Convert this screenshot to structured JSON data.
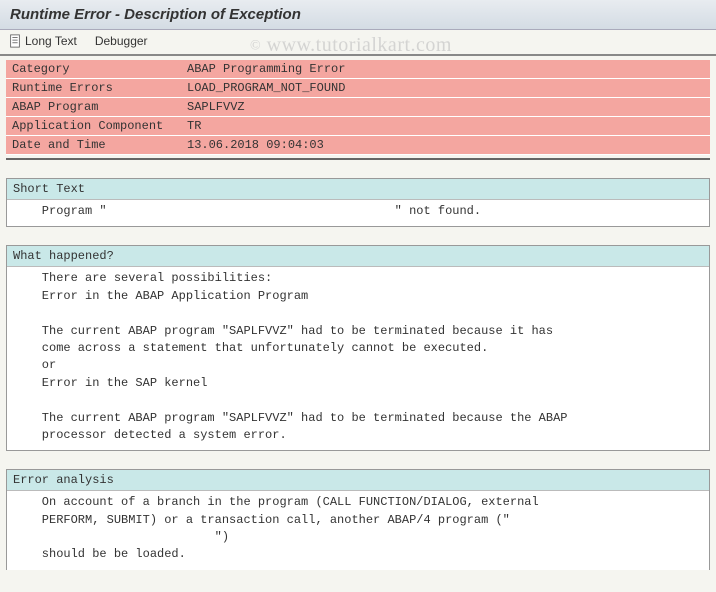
{
  "title": "Runtime Error - Description of Exception",
  "toolbar": {
    "long_text_label": "Long Text",
    "debugger_label": "Debugger"
  },
  "info_rows": [
    {
      "label": "Category",
      "value": "ABAP Programming Error"
    },
    {
      "label": "Runtime Errors",
      "value": "LOAD_PROGRAM_NOT_FOUND"
    },
    {
      "label": "ABAP Program",
      "value": "SAPLFVVZ"
    },
    {
      "label": "Application Component",
      "value": "TR"
    },
    {
      "label": "Date and Time",
      "value": "13.06.2018 09:04:03"
    }
  ],
  "sections": {
    "short_text": {
      "header": "Short Text",
      "line1": "    Program \"                                        \" not found."
    },
    "what_happened": {
      "header": "What happened?",
      "l1": "    There are several possibilities:",
      "l2": "    Error in the ABAP Application Program",
      "l3": "",
      "l4": "    The current ABAP program \"SAPLFVVZ\" had to be terminated because it has",
      "l5": "    come across a statement that unfortunately cannot be executed.",
      "l6": "    or",
      "l7": "    Error in the SAP kernel",
      "l8": "",
      "l9": "    The current ABAP program \"SAPLFVVZ\" had to be terminated because the ABAP",
      "l10": "    processor detected a system error."
    },
    "error_analysis": {
      "header": "Error analysis",
      "l1": "    On account of a branch in the program (CALL FUNCTION/DIALOG, external",
      "l2": "    PERFORM, SUBMIT) or a transaction call, another ABAP/4 program (\"",
      "l3": "                            \")",
      "l4": "    should be be loaded."
    }
  },
  "watermark": "www.tutorialkart.com"
}
